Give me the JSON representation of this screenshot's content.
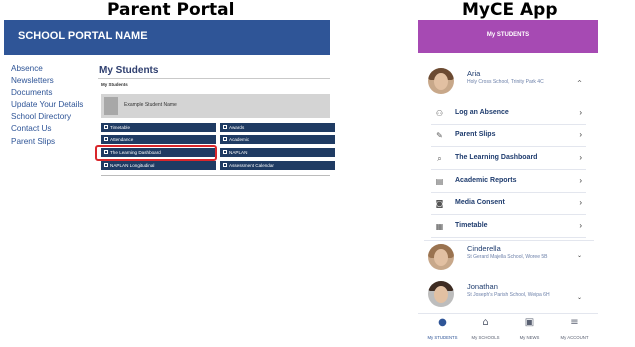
{
  "headings": {
    "left": "Parent Portal",
    "right": "MyCE App"
  },
  "portal": {
    "header_title": "SCHOOL PORTAL NAME",
    "nav": [
      "Absence",
      "Newsletters",
      "Documents",
      "Update Your Details",
      "School Directory",
      "Contact Us",
      "Parent Slips"
    ],
    "main_title": "My Students",
    "sub_title": "My Students",
    "student_card": "Example Student Name",
    "buttons": [
      "Timetable",
      "Awards",
      "Attendance",
      "Academic",
      "The Learning Dashboard",
      "NAPLAN",
      "NAPLAN Longitudinal",
      "Assessment Calendar"
    ],
    "highlight_color": "#d9262b"
  },
  "app": {
    "header_title": "My STUDENTS",
    "accent": "#a64ab3",
    "students": [
      {
        "name": "Aria",
        "school": "Holy Cross School, Trinity Park 4C",
        "chevron": "^"
      },
      {
        "name": "Cinderella",
        "school": "St Gerard Majella School, Woree 5B",
        "chevron": "⌄"
      },
      {
        "name": "Jonathan",
        "school": "St Joseph's Parish School, Weipa 6H",
        "chevron": "⌄"
      }
    ],
    "menu": [
      {
        "label": "Log an Absence",
        "icon": "person-x-icon"
      },
      {
        "label": "Parent Slips",
        "icon": "slip-icon"
      },
      {
        "label": "The Learning Dashboard",
        "icon": "dashboard-search-icon"
      },
      {
        "label": "Academic Reports",
        "icon": "report-icon"
      },
      {
        "label": "Media Consent",
        "icon": "camera-icon"
      },
      {
        "label": "Timetable",
        "icon": "calendar-icon"
      }
    ],
    "tabs": [
      {
        "label": "My STUDENTS",
        "icon": "person-icon"
      },
      {
        "label": "My SCHOOLS",
        "icon": "school-icon"
      },
      {
        "label": "My NEWS",
        "icon": "news-icon"
      },
      {
        "label": "My ACCOUNT",
        "icon": "menu-icon"
      }
    ]
  }
}
